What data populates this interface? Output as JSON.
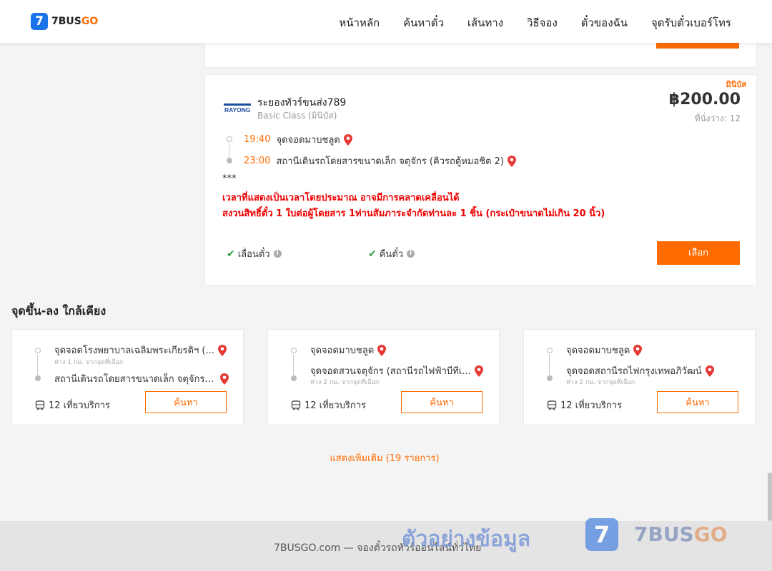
{
  "header": {
    "logo_mark": "7",
    "logo_num": "7BUS",
    "logo_go": "GO",
    "nav": [
      "หน้าหลัก",
      "ค้นหาตั๋ว",
      "เส้นทาง",
      "วิธีจอง",
      "ตั๋วของฉัน",
      "จุดรับตั๋วเบอร์โทร"
    ]
  },
  "trip": {
    "badge": "มินิบัส",
    "operator": "ระยองทัวร์ขนส่ง789",
    "logo_text": "RAYONG",
    "class": "Basic Class (มินิบัส)",
    "price": "฿200.00",
    "seats": "ที่นั่งว่าง: 12",
    "depart_time": "19:40",
    "depart_stop": "จุดจอดมาบชลูด",
    "arrive_time": "23:00",
    "arrive_stop": "สถานีเดินรถโดยสารขนาดเล็ก จตุจักร (คิวรถตู้หมอชิต 2)",
    "note_marker": "***",
    "note_line1": "เวลาที่แสดงเป็นเวลาโดยประมาณ อาจมีการคลาดเคลื่อนได้",
    "note_line2": "สงวนสิทธิ์ตั๋ว 1 ใบต่อผู้โดยสาร 1ท่านสัมภาระจำกัดท่านละ 1 ชิ้น (กระเป๋าขนาดไม่เกิน 20 นิ้ว)",
    "feature_change": "เลื่อนตั๋ว",
    "feature_refund": "คืนตั๋ว",
    "select_label": "เลือก"
  },
  "nearby": {
    "title": "จุดขึ้น-ลง ใกล้เคียง",
    "cards": [
      {
        "from": "จุดจอดโรงพยาบาลเฉลิมพระเกียรติฯ (...",
        "from_dist": "ห่าง 1 กม. จากจุดที่เลือก",
        "to": "สถานีเดินรถโดยสารขนาดเล็ก จตุจักร (...",
        "to_dist": "",
        "trips": "12 เที่ยวบริการ",
        "search": "ค้นหา"
      },
      {
        "from": "จุดจอดมาบชลูด",
        "from_dist": "",
        "to": "จุดจอดสวนจตุจักร (สถานีรถไฟฟ้าบีทีเ...",
        "to_dist": "ห่าง 2 กม. จากจุดที่เลือก",
        "trips": "12 เที่ยวบริการ",
        "search": "ค้นหา"
      },
      {
        "from": "จุดจอดมาบชลูด",
        "from_dist": "",
        "to": "จุดจอดสถานีรถไฟกรุงเทพอภิวัฒน์",
        "to_dist": "ห่าง 2 กม. จากจุดที่เลือก",
        "trips": "12 เที่ยวบริการ",
        "search": "ค้นหา"
      }
    ],
    "show_more": "แสดงเพิ่มเติม (19 รายการ)"
  },
  "footer": {
    "text": "7BUSGO.com — จองตั๋วรถทัวร์ออนไลน์ทั่วไทย",
    "watermark": "ตัวอย่างข้อมูล",
    "wm_mark": "7",
    "wm_brand_a": "7BUS",
    "wm_brand_b": "GO"
  },
  "colors": {
    "accent": "#ff6b00",
    "alert": "#e00000",
    "check": "#2e9e3e",
    "pin": "#e53935"
  }
}
